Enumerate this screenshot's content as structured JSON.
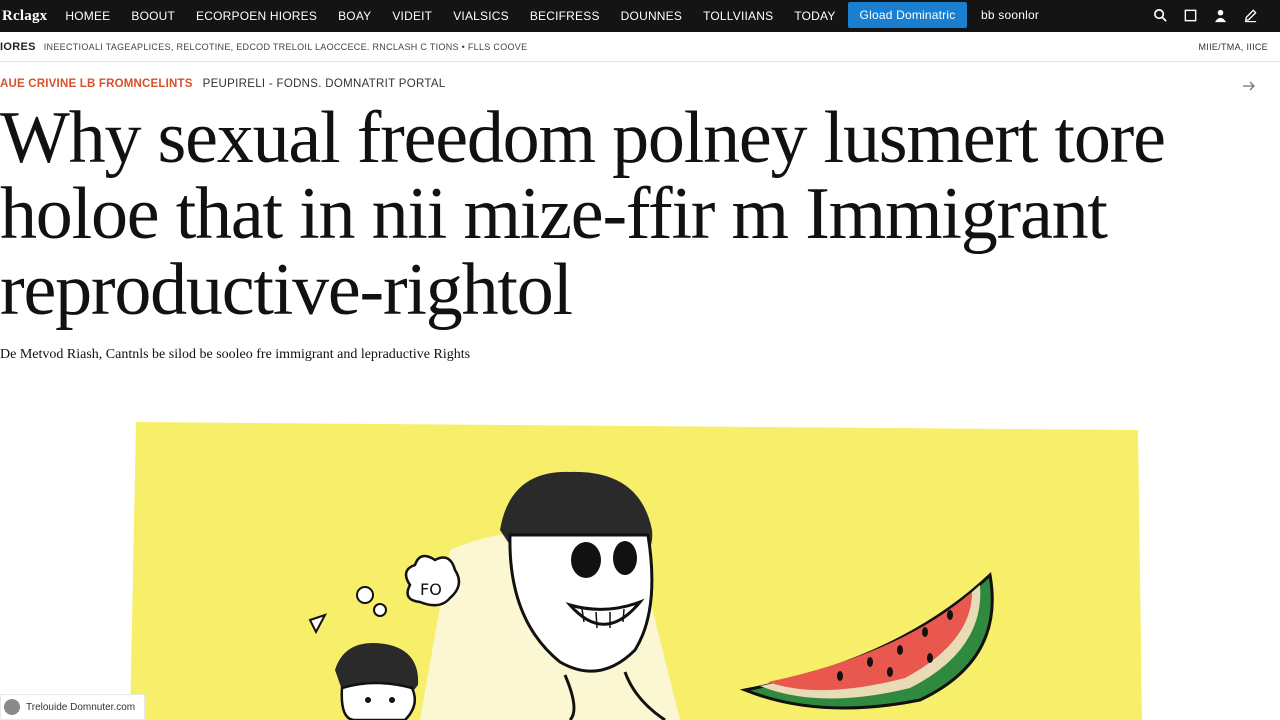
{
  "header": {
    "logo": "Rclagx",
    "nav_items": [
      "HOMEE",
      "BOOUT",
      "ECORPOEN HIORES",
      "BOAY",
      "VIDEIT",
      "VIALSICS",
      "BECIFRESS",
      "DOUNNES",
      "TOLLVIIANS",
      "TODAY"
    ],
    "cta_label": "Gload Dominatric",
    "signin_label": "bb soonlor",
    "icons": [
      "search-icon",
      "square-icon",
      "user-icon",
      "edit-icon"
    ]
  },
  "subnav": {
    "section": "IORES",
    "links": "INEECTIOALI TAGEAPLICES, RELCOTINE, EDCOD TRELOIL LAOCCECE. RNCLASH C TIONS • FLLS COOVE",
    "right": "MIIE/TMA, IIICE"
  },
  "article": {
    "kicker_category": "AUE CRIVINE LB FROMNCELINTS",
    "kicker_meta": "PEUPIRELI - FODNS. DOMNATRIT PORTAL",
    "headline_lines": [
      "Why sexual freedom polney lusmert tore",
      "holoe that in nii mize-ffir m Immigrant",
      "reproductive-rightol"
    ],
    "dek": "De Metvod Riash, Cantnls be silod be sooleo fre immigrant and lepraductive Rights"
  },
  "illustration": {
    "bubble_text": "FO"
  },
  "source": {
    "label": "Trelouide Domnuter.com"
  },
  "colors": {
    "nav_bg": "#141414",
    "cta_bg": "#1a7fd0",
    "kicker": "#d9502c",
    "illustration_bg": "#f7ef6a"
  }
}
